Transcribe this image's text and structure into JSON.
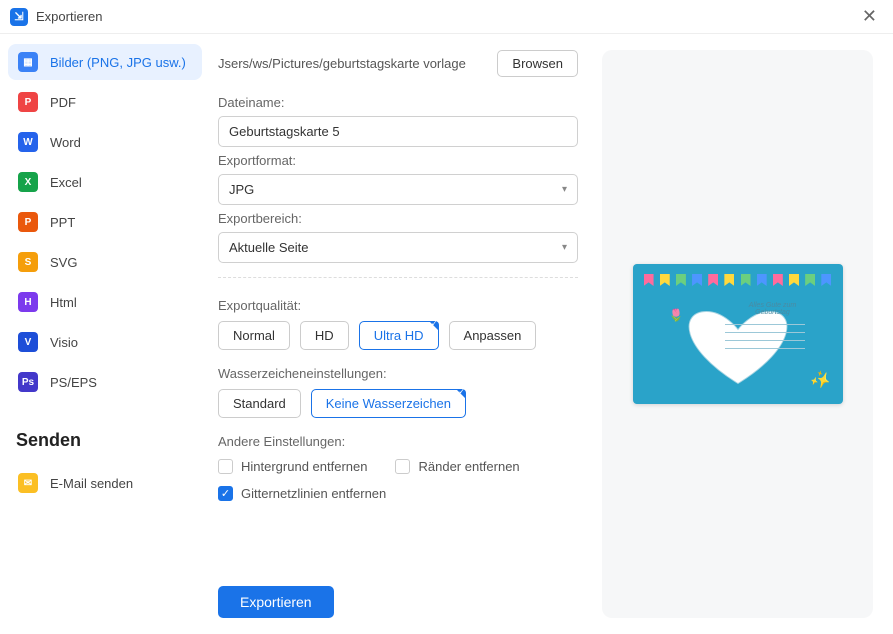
{
  "window": {
    "title": "Exportieren"
  },
  "sidebar": {
    "items": [
      {
        "label": "Bilder (PNG, JPG usw.)"
      },
      {
        "label": "PDF"
      },
      {
        "label": "Word"
      },
      {
        "label": "Excel"
      },
      {
        "label": "PPT"
      },
      {
        "label": "SVG"
      },
      {
        "label": "Html"
      },
      {
        "label": "Visio"
      },
      {
        "label": "PS/EPS"
      }
    ],
    "send_title": "Senden",
    "send_items": [
      {
        "label": "E-Mail senden"
      }
    ]
  },
  "form": {
    "path": "Jsers/ws/Pictures/geburtstagskarte vorlage",
    "browse": "Browsen",
    "filename_label": "Dateiname:",
    "filename": "Geburtstagskarte 5",
    "format_label": "Exportformat:",
    "format": "JPG",
    "range_label": "Exportbereich:",
    "range": "Aktuelle Seite",
    "quality_label": "Exportqualität:",
    "quality": {
      "normal": "Normal",
      "hd": "HD",
      "ultra": "Ultra HD",
      "custom": "Anpassen"
    },
    "watermark_label": "Wasserzeicheneinstellungen:",
    "watermark": {
      "standard": "Standard",
      "none": "Keine Wasserzeichen"
    },
    "other_label": "Andere Einstellungen:",
    "check_bg": "Hintergrund entfernen",
    "check_margin": "Ränder entfernen",
    "check_grid": "Gitternetzlinien entfernen",
    "export": "Exportieren"
  },
  "preview": {
    "headline": "Alles Gute zum Geburtstag"
  }
}
